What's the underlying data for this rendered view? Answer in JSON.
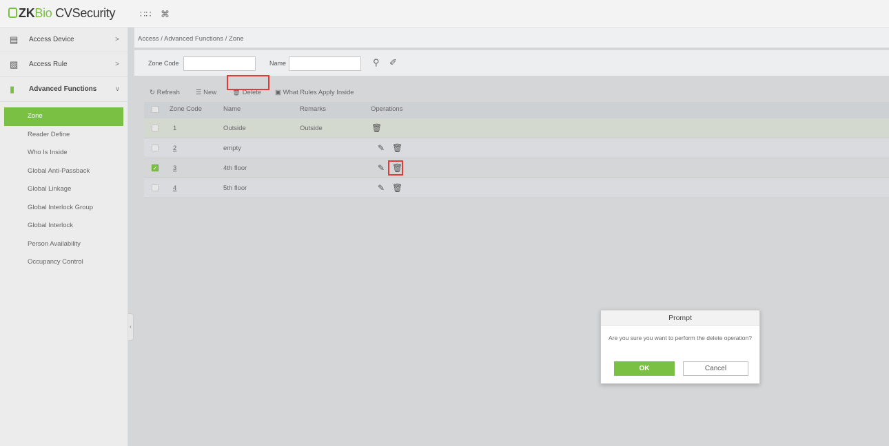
{
  "header": {
    "logo": {
      "zk": "ZK",
      "bio": "Bio",
      "cv": " CVSecurity"
    },
    "icons": [
      "apps-grid-icon",
      "command-icon"
    ]
  },
  "breadcrumb": "Access / Advanced Functions / Zone",
  "sidebar": {
    "groups": [
      {
        "label": "Access Device",
        "icon": "device-icon",
        "chevron": ">"
      },
      {
        "label": "Access Rule",
        "icon": "rule-icon",
        "chevron": ">"
      },
      {
        "label": "Advanced Functions",
        "icon": "door-icon",
        "chevron": "v"
      }
    ],
    "sub_items": [
      {
        "label": "Zone",
        "active": true
      },
      {
        "label": "Reader Define"
      },
      {
        "label": "Who Is Inside"
      },
      {
        "label": "Global Anti-Passback"
      },
      {
        "label": "Global Linkage"
      },
      {
        "label": "Global Interlock Group"
      },
      {
        "label": "Global Interlock"
      },
      {
        "label": "Person Availability"
      },
      {
        "label": "Occupancy Control"
      }
    ]
  },
  "search": {
    "zone_code_label": "Zone Code",
    "zone_code_value": "",
    "name_label": "Name",
    "name_value": ""
  },
  "toolbar": {
    "refresh": "Refresh",
    "new": "New",
    "delete": "Delete",
    "what_rules": "What Rules Apply Inside"
  },
  "table": {
    "columns": [
      "Zone Code",
      "Name",
      "Remarks",
      "Operations"
    ],
    "rows": [
      {
        "code": "1",
        "name": "Outside",
        "remarks": "Outside",
        "checked": false
      },
      {
        "code": "2",
        "name": "empty",
        "remarks": "",
        "checked": false
      },
      {
        "code": "3",
        "name": "4th floor",
        "remarks": "",
        "checked": true
      },
      {
        "code": "4",
        "name": "5th floor",
        "remarks": "",
        "checked": false
      }
    ]
  },
  "dialog": {
    "title": "Prompt",
    "message": "Are you sure you want to perform the delete operation?",
    "ok": "OK",
    "cancel": "Cancel"
  },
  "colors": {
    "accent": "#7ac143",
    "highlight": "#e53935"
  }
}
